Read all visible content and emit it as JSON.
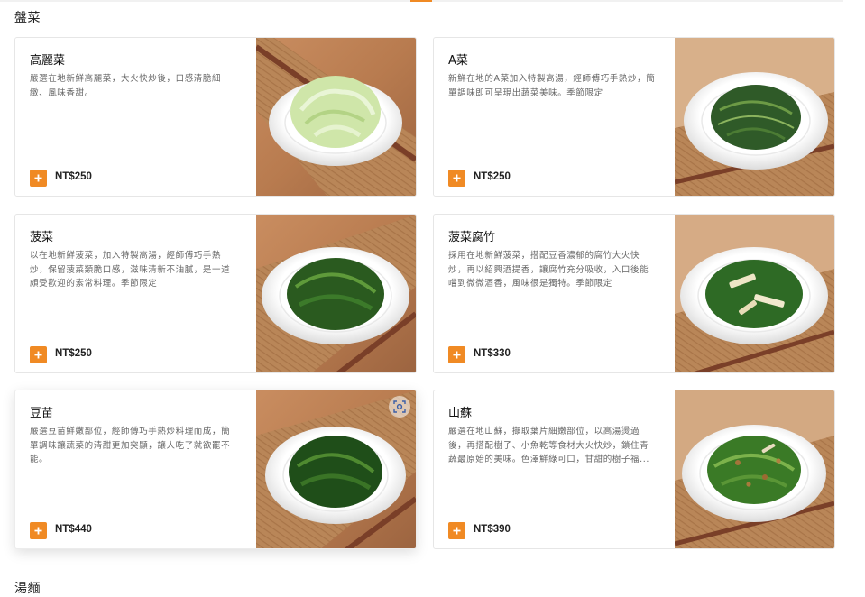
{
  "sections": {
    "plates_title": "盤菜",
    "soup_title": "湯麵"
  },
  "items": [
    {
      "name": "高麗菜",
      "desc": "嚴選在地新鮮高麗菜，大火快炒後，口感清脆細緻、風味香甜。",
      "price": "NT$250"
    },
    {
      "name": "A菜",
      "desc": "新鮮在地的A菜加入特製高湯，經師傅巧手熱炒，簡單調味即可呈現出蔬菜美味。季節限定",
      "price": "NT$250"
    },
    {
      "name": "菠菜",
      "desc": "以在地新鮮菠菜，加入特製高湯，經師傅巧手熱炒，保留菠菜類脆口感，滋味清新不油膩，是一道頗受歡迎的素常料理。季節限定",
      "price": "NT$250"
    },
    {
      "name": "菠菜腐竹",
      "desc": "採用在地新鮮菠菜，搭配豆香濃郁的腐竹大火快炒，再以紹興酒提香，讓腐竹充分吸收，入口後能嚐到微微酒香，風味很是獨特。季節限定",
      "price": "NT$330"
    },
    {
      "name": "豆苗",
      "desc": "嚴選豆苗鮮嫩部位，經師傅巧手熱炒料理而成，簡單調味讓蔬菜的清甜更加突顯，讓人吃了就欲罷不能。",
      "price": "NT$440"
    },
    {
      "name": "山蘇",
      "desc": "嚴選在地山蘇，擷取葉片細嫩部位，以高湯燙過後，再搭配樹子、小魚乾等食材大火快炒，鎖住青蔬最原始的美味。色澤鮮綠可口，甘甜的樹子福...",
      "price": "NT$390"
    }
  ],
  "colors": {
    "accent": "#f08a24",
    "card_border": "#e6e6e6",
    "desc_text": "#666666"
  },
  "icons": {
    "add": "plus-icon",
    "visual_search": "visual-search-icon"
  }
}
